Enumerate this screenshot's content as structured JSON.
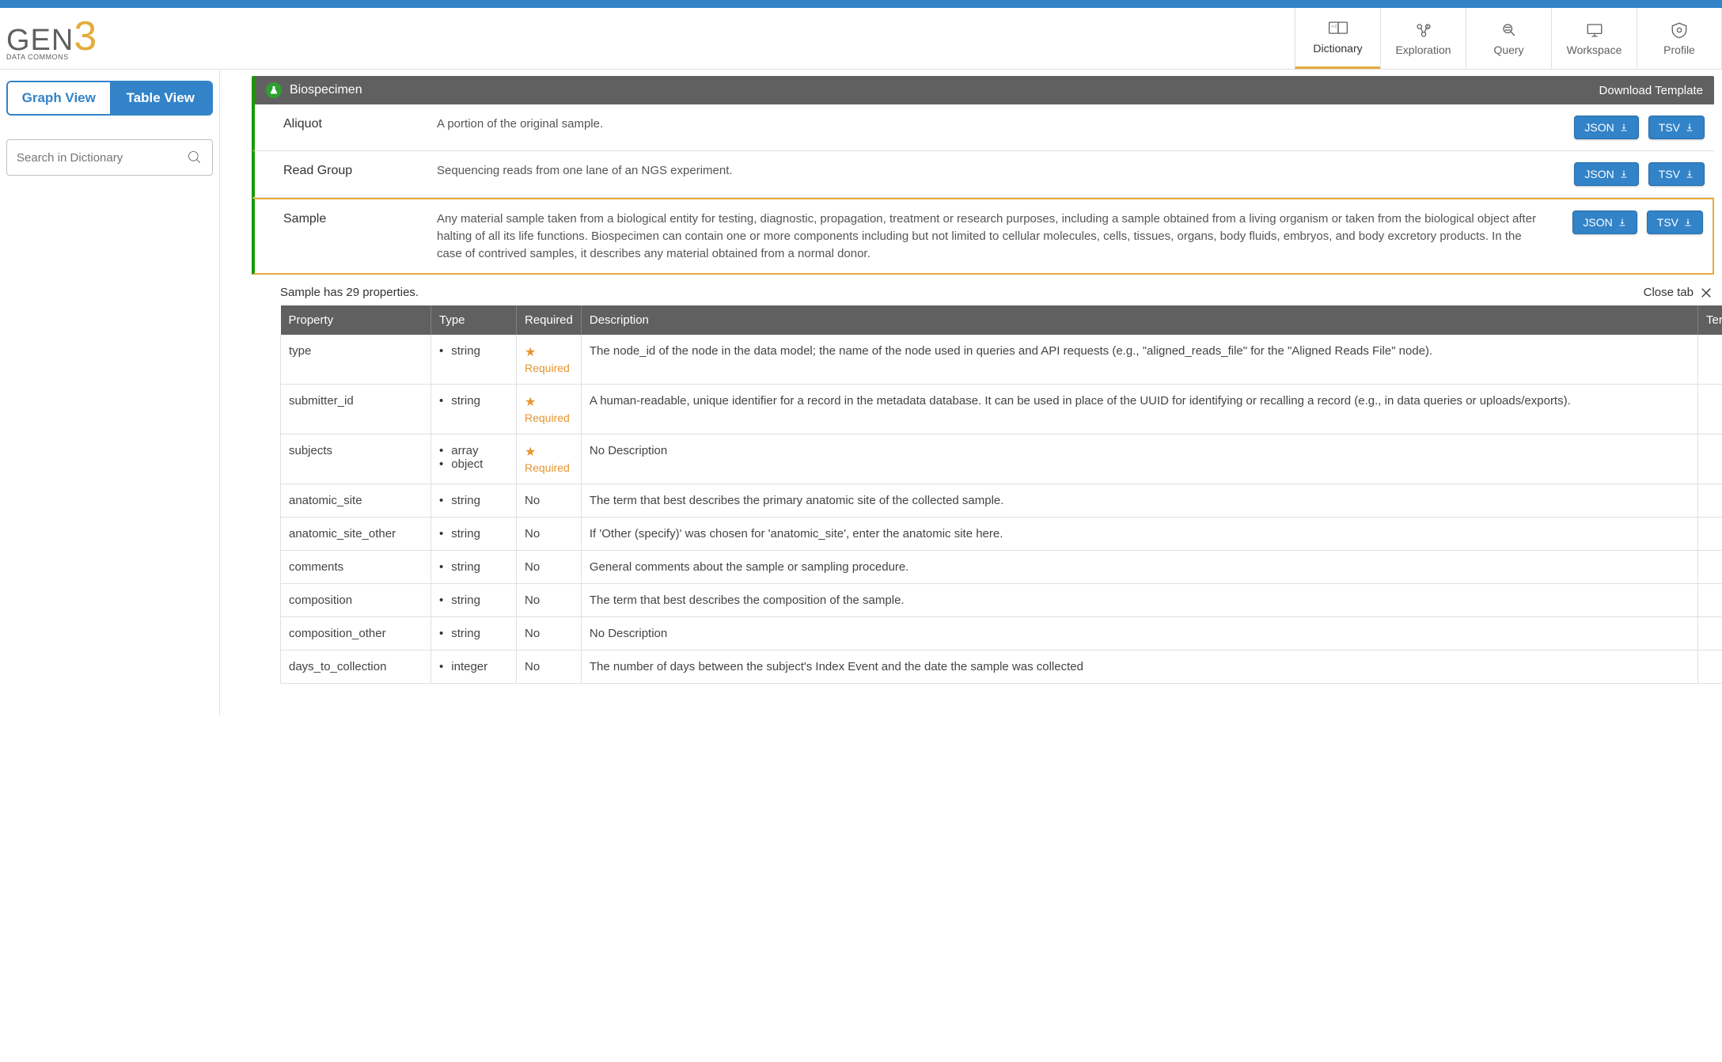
{
  "logo": {
    "main": "GEN",
    "accent": "3",
    "sub": "DATA COMMONS"
  },
  "nav": [
    {
      "label": "Dictionary",
      "active": true
    },
    {
      "label": "Exploration",
      "active": false
    },
    {
      "label": "Query",
      "active": false
    },
    {
      "label": "Workspace",
      "active": false
    },
    {
      "label": "Profile",
      "active": false
    }
  ],
  "sidebar": {
    "view_graph": "Graph View",
    "view_table": "Table View",
    "search_placeholder": "Search in Dictionary"
  },
  "category": {
    "title": "Biospecimen",
    "download_template": "Download Template"
  },
  "buttons": {
    "json": "JSON",
    "tsv": "TSV"
  },
  "nodes": [
    {
      "name": "Aliquot",
      "desc": "A portion of the original sample.",
      "selected": false
    },
    {
      "name": "Read Group",
      "desc": "Sequencing reads from one lane of an NGS experiment.",
      "selected": false
    },
    {
      "name": "Sample",
      "desc": "Any material sample taken from a biological entity for testing, diagnostic, propagation, treatment or research purposes, including a sample obtained from a living organism or taken from the biological object after halting of all its life functions. Biospecimen can contain one or more components including but not limited to cellular molecules, cells, tissues, organs, body fluids, embryos, and body excretory products. In the case of contrived samples, it describes any material obtained from a normal donor.",
      "selected": true
    }
  ],
  "properties_panel": {
    "count_text": "Sample has 29 properties.",
    "close_label": "Close tab",
    "headers": {
      "property": "Property",
      "type": "Type",
      "required": "Required",
      "description": "Description",
      "term": "Term"
    },
    "required_label": "Required",
    "no_label": "No",
    "rows": [
      {
        "property": "type",
        "types": [
          "string"
        ],
        "required": true,
        "description": "The node_id of the node in the data model; the name of the node used in queries and API requests (e.g., \"aligned_reads_file\" for the \"Aligned Reads File\" node).",
        "term": ""
      },
      {
        "property": "submitter_id",
        "types": [
          "string"
        ],
        "required": true,
        "description": "A human-readable, unique identifier for a record in the metadata database. It can be used in place of the UUID for identifying or recalling a record (e.g., in data queries or uploads/exports).",
        "term": ""
      },
      {
        "property": "subjects",
        "types": [
          "array",
          "object"
        ],
        "required": true,
        "description": "No Description",
        "term": ""
      },
      {
        "property": "anatomic_site",
        "types": [
          "string"
        ],
        "required": false,
        "description": "The term that best describes the primary anatomic site of the collected sample.",
        "term": ""
      },
      {
        "property": "anatomic_site_other",
        "types": [
          "string"
        ],
        "required": false,
        "description": "If 'Other (specify)' was chosen for 'anatomic_site', enter the anatomic site here.",
        "term": ""
      },
      {
        "property": "comments",
        "types": [
          "string"
        ],
        "required": false,
        "description": "General comments about the sample or sampling procedure.",
        "term": ""
      },
      {
        "property": "composition",
        "types": [
          "string"
        ],
        "required": false,
        "description": "The term that best describes the composition of the sample.",
        "term": ""
      },
      {
        "property": "composition_other",
        "types": [
          "string"
        ],
        "required": false,
        "description": "No Description",
        "term": ""
      },
      {
        "property": "days_to_collection",
        "types": [
          "integer"
        ],
        "required": false,
        "description": "The number of days between the subject's Index Event and the date the sample was collected",
        "term": ""
      }
    ]
  }
}
